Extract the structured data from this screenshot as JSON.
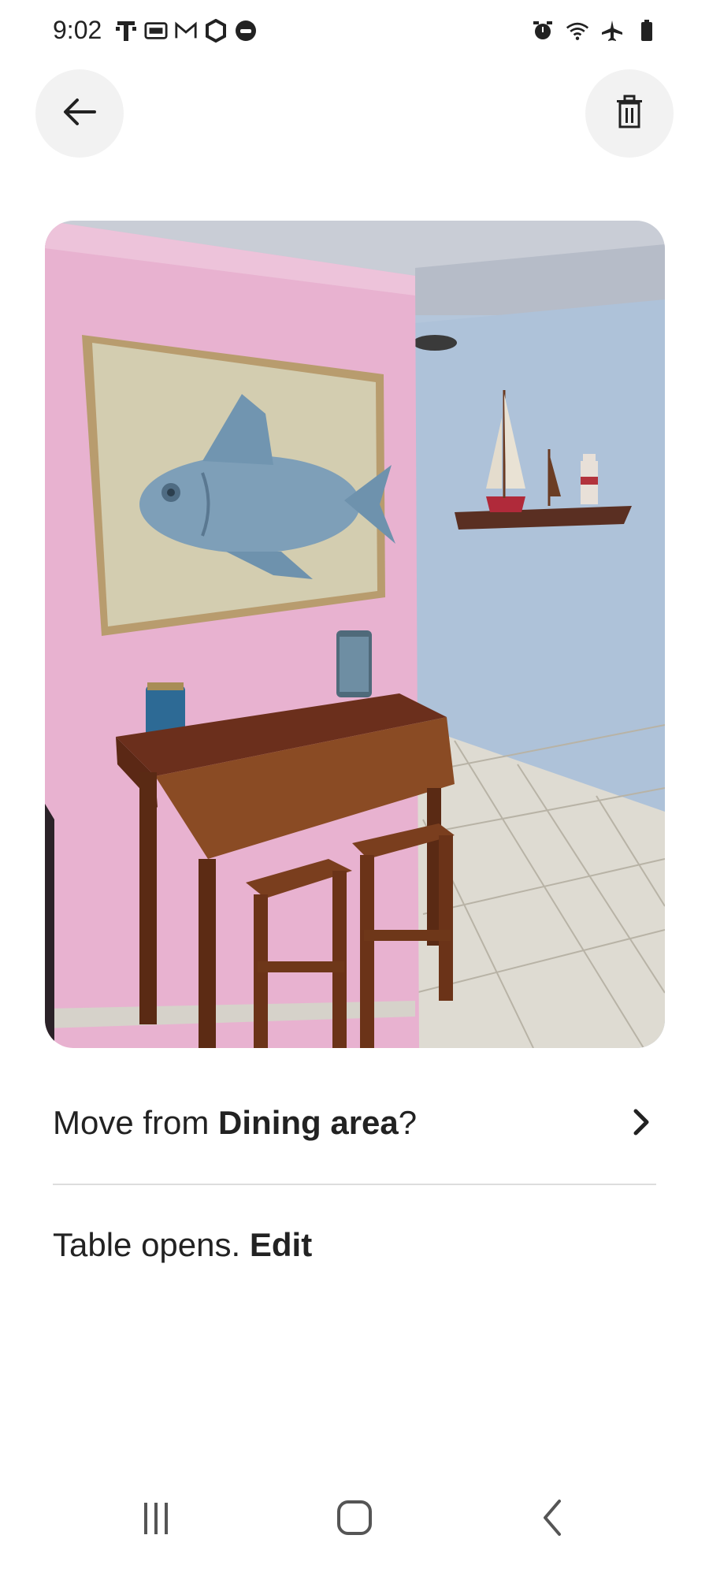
{
  "status_bar": {
    "time": "9:02",
    "left_icons": [
      "t-mobile-icon",
      "messages-icon",
      "gmail-icon",
      "settings-icon",
      "game-icon"
    ],
    "right_icons": [
      "alarm-icon",
      "wifi-icon",
      "airplane-icon",
      "battery-icon"
    ]
  },
  "toolbar": {
    "back_icon": "arrow-left-icon",
    "delete_icon": "trash-icon"
  },
  "move_row": {
    "prefix": "Move from ",
    "room": "Dining area",
    "suffix": "?"
  },
  "note_row": {
    "text": "Table opens. ",
    "action": "Edit"
  },
  "nav_bar": {
    "icons": [
      "recents-icon",
      "home-icon",
      "back-icon"
    ]
  },
  "colors": {
    "accent_text": "#222222",
    "divider": "#dddddd",
    "button_bg": "#f2f2f2"
  }
}
